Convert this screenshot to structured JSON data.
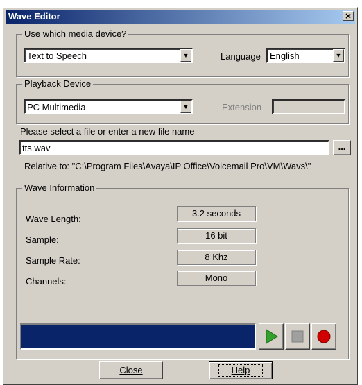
{
  "window": {
    "title": "Wave Editor",
    "close_glyph": "×"
  },
  "media": {
    "legend": "Use which media device?",
    "device_value": "Text to Speech",
    "language_label": "Language",
    "language_value": "English"
  },
  "playback": {
    "legend": "Playback Device",
    "device_value": "PC Multimedia",
    "extension_label": "Extension",
    "extension_value": ""
  },
  "file": {
    "prompt": "Please select a file or enter a new file name",
    "value": "tts.wav",
    "browse_label": "...",
    "relative_text": "Relative to: \"C:\\Program Files\\Avaya\\IP Office\\Voicemail Pro\\VM\\Wavs\\\""
  },
  "wave": {
    "legend": "Wave Information",
    "rows": [
      {
        "label": "Wave Length:",
        "value": "3.2 seconds"
      },
      {
        "label": "Sample:",
        "value": "16 bit"
      },
      {
        "label": "Sample Rate:",
        "value": "8 Khz"
      },
      {
        "label": "Channels:",
        "value": "Mono"
      }
    ]
  },
  "controls": {
    "play_icon": "play-icon",
    "stop_icon": "stop-icon",
    "record_icon": "record-icon",
    "colors": {
      "play": "#33a02c",
      "stop": "#a0a0a0",
      "record": "#d00000",
      "progress": "#0a246a"
    }
  },
  "buttons": {
    "close_label": "Close",
    "help_label": "Help"
  }
}
